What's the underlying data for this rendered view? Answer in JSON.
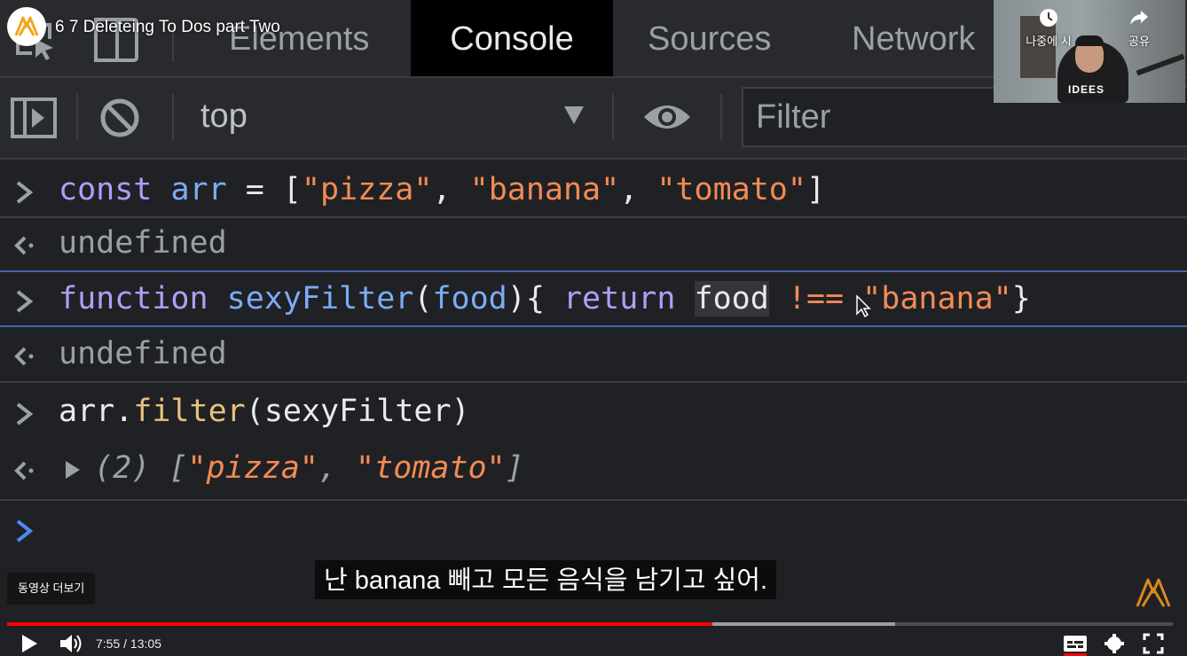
{
  "video": {
    "title": "6 7 Deleteing To Dos part Two",
    "time_current": "7:55",
    "time_separator": " / ",
    "time_total": "13:05",
    "progress_played": 0.605,
    "progress_loaded": 0.762,
    "subtitle": "난 banana 빼고 모든 음식을 남기고 싶어.",
    "more_videos_label": "동영상 더보기",
    "watch_later_label": "나중에 시",
    "share_label": "공유",
    "webcam_shirt_text": "IDEES",
    "accent_color": "#ff0000"
  },
  "devtools": {
    "tabs": [
      {
        "label": "Elements",
        "active": false
      },
      {
        "label": "Console",
        "active": true
      },
      {
        "label": "Sources",
        "active": false
      },
      {
        "label": "Network",
        "active": false
      }
    ],
    "toolbar": {
      "context": "top",
      "filter_placeholder": "Filter"
    },
    "console": {
      "line1": {
        "kw": "const",
        "var": "arr",
        "eq": " = ",
        "open": "[",
        "s1": "\"pizza\"",
        "c1": ", ",
        "s2": "\"banana\"",
        "c2": ", ",
        "s3": "\"tomato\"",
        "close": "]"
      },
      "result1": "undefined",
      "line2": {
        "kw": "function",
        "name": "sexyFilter",
        "open": "(",
        "param": "food",
        "close": "){",
        "ret": "return",
        "food": "food",
        "op": "!==",
        "str": "\"banana\"",
        "end": "}"
      },
      "result2": "undefined",
      "line3": {
        "obj": "arr",
        "dot": ".",
        "method": "filter",
        "open": "(",
        "arg": "sexyFilter",
        "close": ")"
      },
      "result3": {
        "count": "(2)",
        "open": "[",
        "s1": "\"pizza\"",
        "c1": ", ",
        "s2": "\"tomato\"",
        "close": "]"
      }
    }
  }
}
